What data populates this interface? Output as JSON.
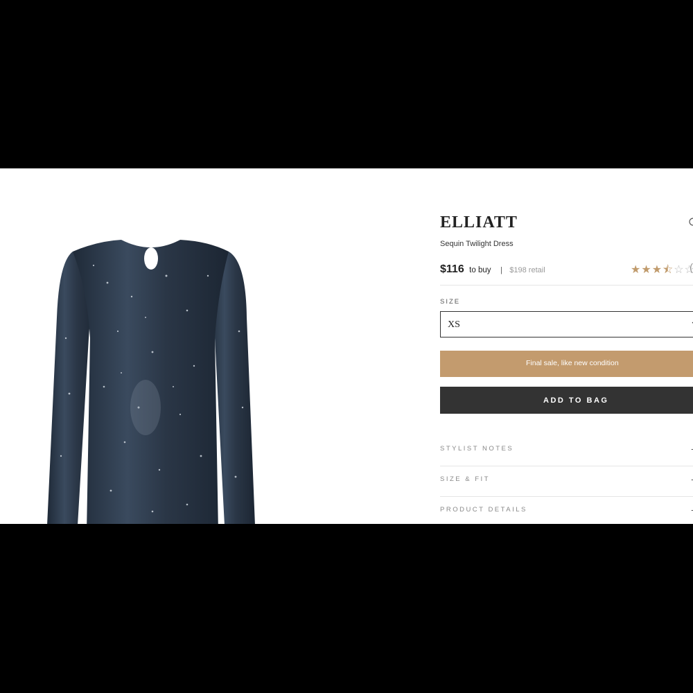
{
  "product": {
    "brand": "ELLIATT",
    "name": "Sequin Twilight Dress",
    "price": "$116",
    "price_suffix": "to buy",
    "divider": "|",
    "retail": "$198 retail",
    "rating": {
      "value": 3.5,
      "out_of": 5,
      "stars_filled": "★★★",
      "stars_half": "⯪",
      "stars_empty": "☆☆",
      "count_partial": "("
    }
  },
  "size": {
    "label": "SIZE",
    "selected": "XS"
  },
  "buttons": {
    "condition": "Final sale, like new condition",
    "add_to_bag": "ADD TO BAG"
  },
  "accordion": [
    {
      "label": "STYLIST NOTES"
    },
    {
      "label": "SIZE & FIT"
    },
    {
      "label": "PRODUCT DETAILS"
    }
  ],
  "colors": {
    "accent": "#c39b6e",
    "dark_button": "#333333",
    "dress": "#2b3848"
  },
  "icons": {
    "share": "share-icon",
    "chevron": "chevron-down-icon",
    "expand": "plus-icon"
  }
}
